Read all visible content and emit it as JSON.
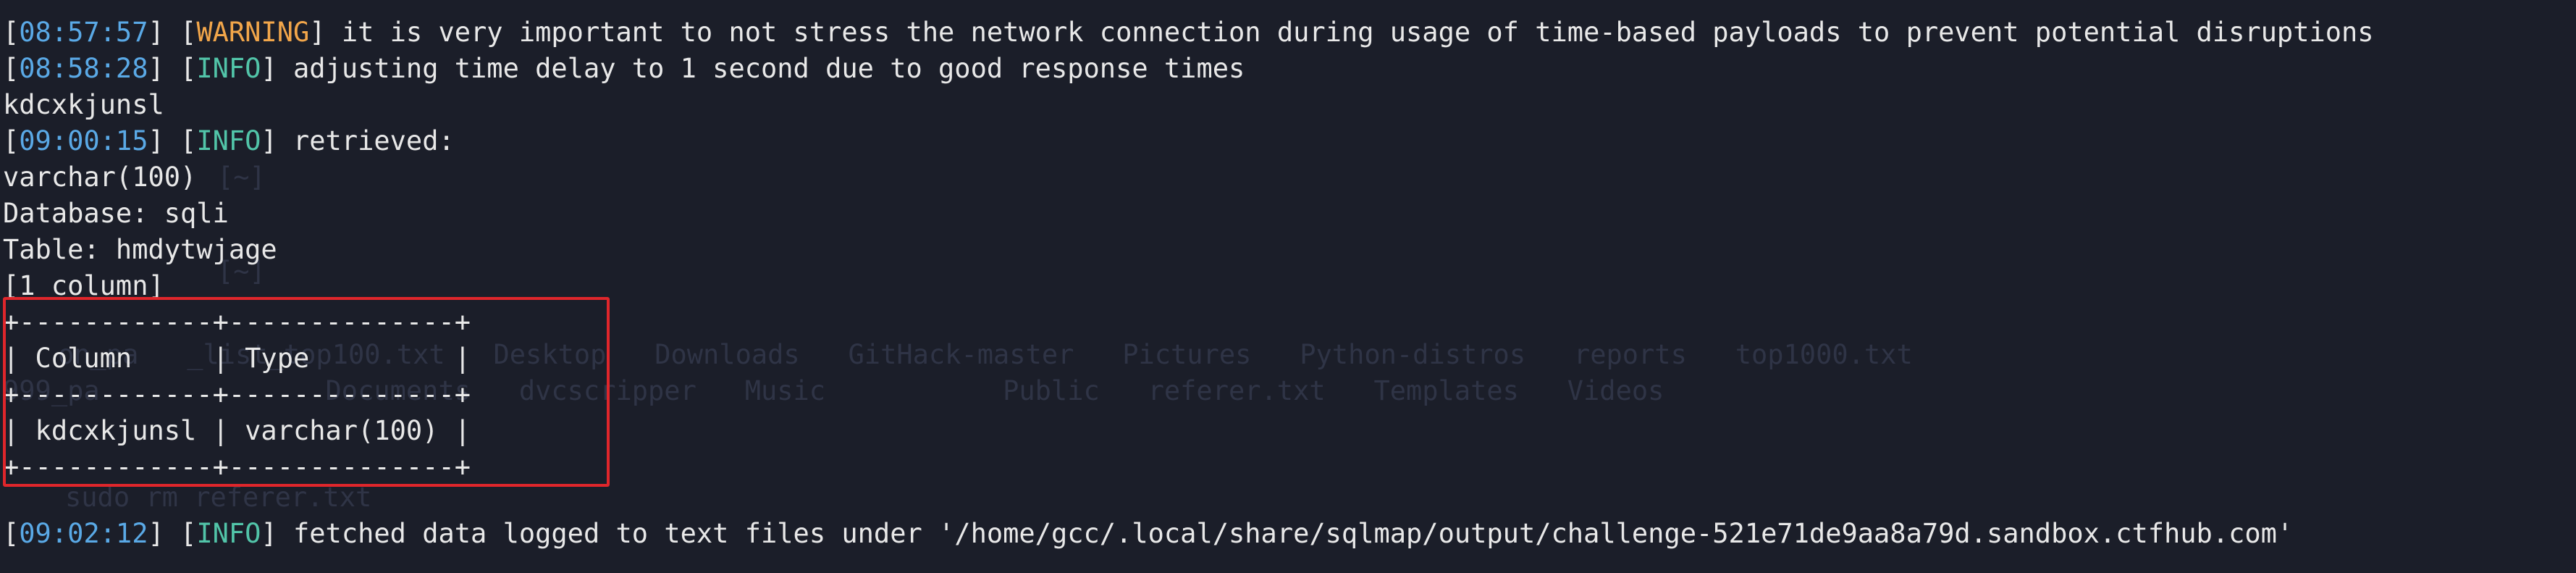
{
  "terminal": {
    "ghost_lines": [
      "[~]",
      "[~]",
      "on_pa   _list_top100.txt   Desktop   Downloads   GitHack-master   Pictures   Python-distros   reports   top1000.txt",
      "999_pa              Documents   dvcscripper   Music           Public   referer.txt   Templates   Videos",
      "sudo rm referer.txt"
    ],
    "log": [
      {
        "ts": "08:57:57",
        "level": "WARNING",
        "msg": " it is very important to not stress the network connection during usage of time-based payloads to prevent potential disruptions"
      },
      {
        "ts": "08:58:28",
        "level": "INFO",
        "msg": " adjusting time delay to 1 second due to good response times"
      }
    ],
    "plain_1": "kdcxkjunsl",
    "retrieved": {
      "ts": "09:00:15",
      "level": "INFO",
      "msg": " retrieved:"
    },
    "plain_2": "varchar(100)",
    "database_line": "Database: sqli",
    "table_line": "Table: hmdytwjage",
    "column_count_line": "[1 column]",
    "table": {
      "border_top": "+------------+--------------+",
      "header": "| Column     | Type         |",
      "border_mid": "+------------+--------------+",
      "row": "| kdcxkjunsl | varchar(100) |",
      "border_bottom": "+------------+--------------+"
    },
    "footer": {
      "ts": "09:02:12",
      "level": "INFO",
      "msg": " fetched data logged to text files under '/home/gcc/.local/share/sqlmap/output/challenge-521e71de9aa8a79d.sandbox.ctfhub.com'"
    },
    "colors": {
      "background": "#1b1e29",
      "timestamp": "#5aa9e6",
      "info": "#52c5a9",
      "warning": "#f2a64a",
      "highlight_box": "#e0262b"
    }
  }
}
